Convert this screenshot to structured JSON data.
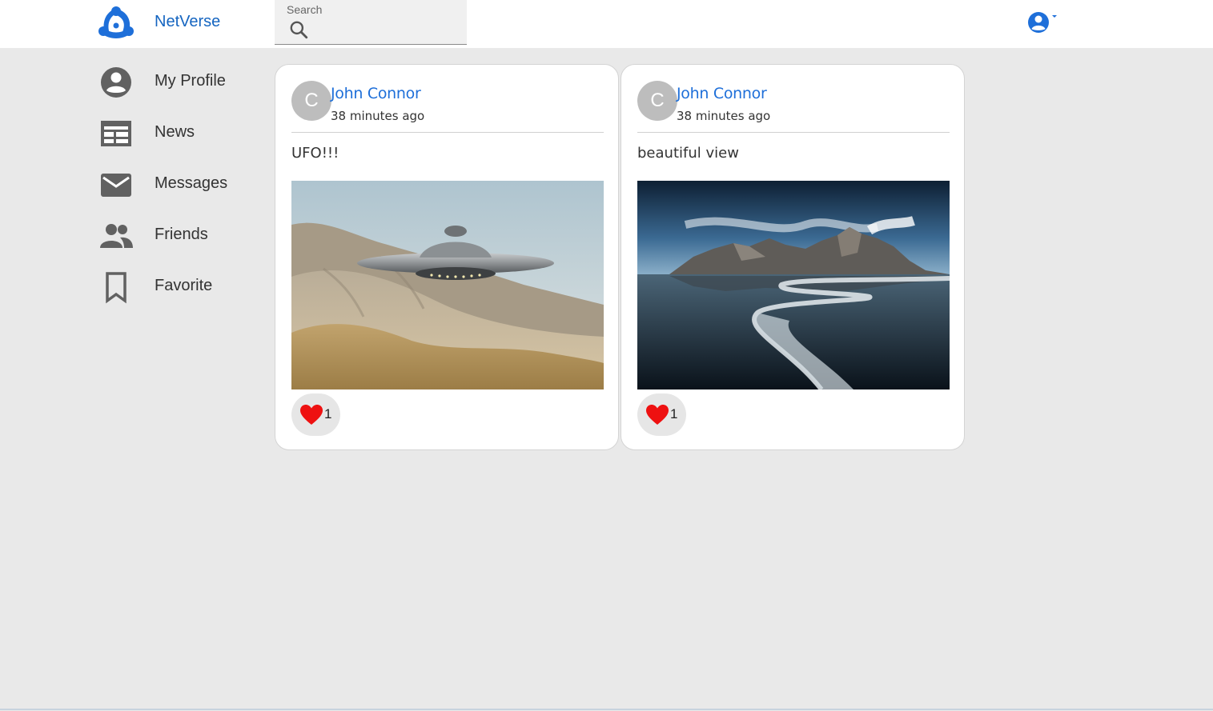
{
  "app": {
    "brand": "NetVerse"
  },
  "search": {
    "label": "Search"
  },
  "sidebar": {
    "items": [
      {
        "label": "My Profile",
        "icon": "account-circle-icon"
      },
      {
        "label": "News",
        "icon": "newspaper-icon"
      },
      {
        "label": "Messages",
        "icon": "mail-icon"
      },
      {
        "label": "Friends",
        "icon": "people-icon"
      },
      {
        "label": "Favorite",
        "icon": "bookmark-icon"
      }
    ]
  },
  "posts": [
    {
      "avatar_letter": "C",
      "author": "John Connor",
      "time": "38 minutes ago",
      "text": "UFO!!!",
      "likes": "1",
      "image": "ufo-over-hills-photo"
    },
    {
      "avatar_letter": "C",
      "author": "John Connor",
      "time": "38 minutes ago",
      "text": "beautiful view",
      "likes": "1",
      "image": "mountain-beach-photo"
    }
  ],
  "colors": {
    "brand_blue": "#1565c0",
    "link_blue": "#1e6fd9",
    "heart_red": "#ee1111",
    "background": "#e9e9e9"
  }
}
